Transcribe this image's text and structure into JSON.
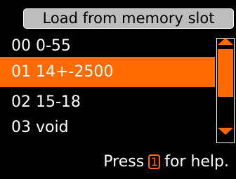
{
  "title": "Load from memory slot",
  "slots": [
    {
      "label": "00 0-55",
      "selected": false
    },
    {
      "label": "01 14+-2500",
      "selected": true
    },
    {
      "label": "02 15-18",
      "selected": false
    },
    {
      "label": "03 void",
      "selected": false
    }
  ],
  "help": {
    "prefix": "Press",
    "key": "1",
    "suffix": "for help."
  },
  "colors": {
    "accent": "#ff6a00",
    "background": "#000000",
    "title_bg": "#bdbdbd",
    "text": "#ffffff"
  },
  "icons": {
    "scroll_up": "triangle-up-icon",
    "scroll_down": "triangle-down-icon"
  }
}
